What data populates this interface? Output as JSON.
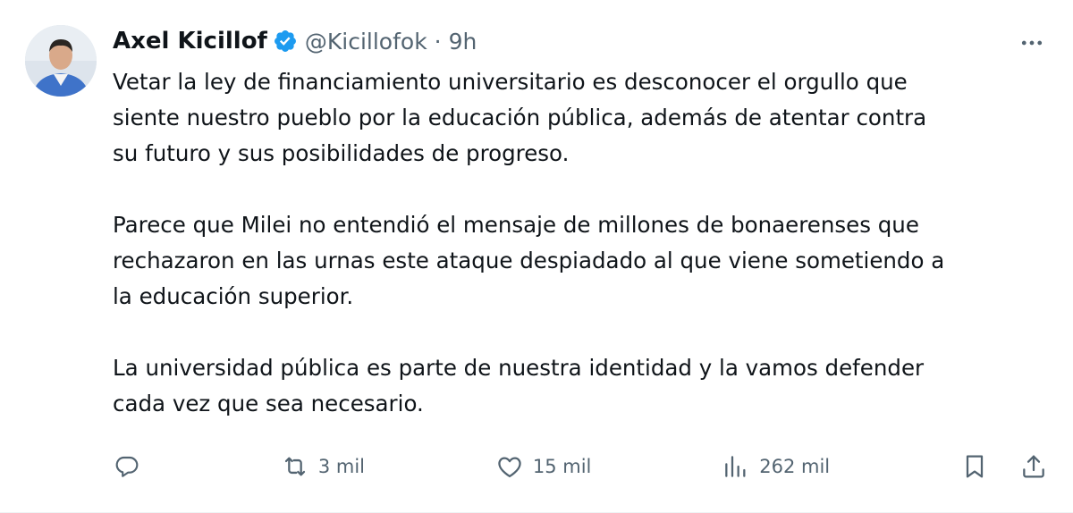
{
  "tweet": {
    "author": {
      "name": "Axel Kicillof",
      "handle": "@Kicillofok",
      "verified": true
    },
    "separator": "·",
    "time": "9h",
    "paragraphs": [
      "Vetar la ley de financiamiento universitario es desconocer el orgullo que\nsiente nuestro pueblo por la educación pública, además de atentar contra\nsu futuro y sus posibilidades de progreso.",
      "Parece que Milei no entendió el mensaje de millones de bonaerenses que\nrechazaron en las urnas este ataque despiadado al que viene sometiendo a\nla educación superior.",
      "La universidad pública es parte de nuestra identidad y la vamos defender\ncada vez que sea necesario."
    ],
    "stats": {
      "replies": "",
      "reposts": "3 mil",
      "likes": "15 mil",
      "views": "262 mil"
    }
  },
  "colors": {
    "text": "#0f1419",
    "secondary": "#536471",
    "verified": "#1d9bf0",
    "border": "#eff3f4"
  },
  "icons": {
    "verified": "verified-badge-icon",
    "more": "more-dots-icon",
    "reply": "reply-icon",
    "repost": "repost-icon",
    "like": "heart-icon",
    "views": "views-chart-icon",
    "bookmark": "bookmark-icon",
    "share": "share-icon"
  }
}
